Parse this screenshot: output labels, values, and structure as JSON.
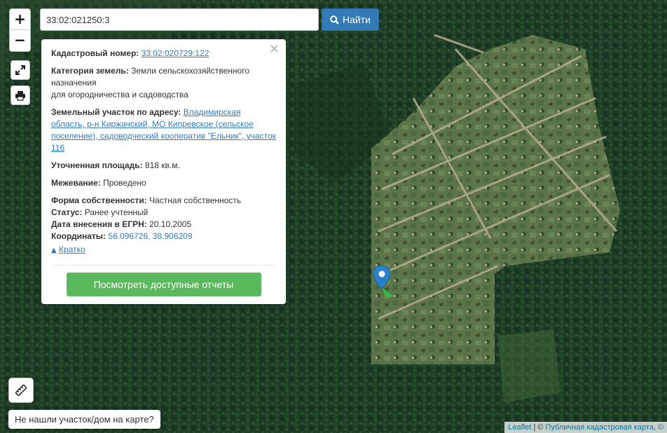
{
  "search": {
    "value": "33:02:021250:3",
    "button_label": "Найти"
  },
  "zoom": {
    "in_label": "+",
    "out_label": "−"
  },
  "popup": {
    "cadastral_label": "Кадастровый номер:",
    "cadastral_value": "33:02:020729:122",
    "category_label": "Категория земель:",
    "category_value": "Земли сельскохозяйственного назначения",
    "category_sub": "для огородничества и садоводства",
    "address_label": "Земельный участок по адресу:",
    "address_value": "Владимирская область, р-н Киржачский, МО Кипревское (сельское поселение), садоводческий кооператив \"Ельник\", участок 116",
    "area_label": "Уточненная площадь:",
    "area_value": "818 кв.м.",
    "survey_label": "Межевание:",
    "survey_value": "Проведено",
    "ownership_label": "Форма собственности:",
    "ownership_value": "Частная собственность",
    "status_label": "Статус:",
    "status_value": "Ранее учтенный",
    "date_label": "Дата внесения в ЕГРН:",
    "date_value": "20.10.2005",
    "coords_label": "Координаты:",
    "coords_value": "56.096726, 38.906209",
    "brief_label": "Кратко",
    "reports_button": "Посмотреть доступные отчеты"
  },
  "not_found_button": "Не нашли участок/дом на карте?",
  "attribution": {
    "leaflet": "Leaflet",
    "separator": " | © ",
    "source": "Публичная кадастровая карта, ©"
  },
  "icons": {
    "fullscreen": "expand-icon",
    "print": "printer-icon",
    "measure": "ruler-icon",
    "search": "search-icon",
    "close": "close-icon",
    "marker": "map-pin-icon"
  },
  "colors": {
    "primary": "#337ab7",
    "success": "#5cb85c",
    "forest": "#1c3a24",
    "clearing": "#56704a",
    "marker": "#2a81cb"
  }
}
